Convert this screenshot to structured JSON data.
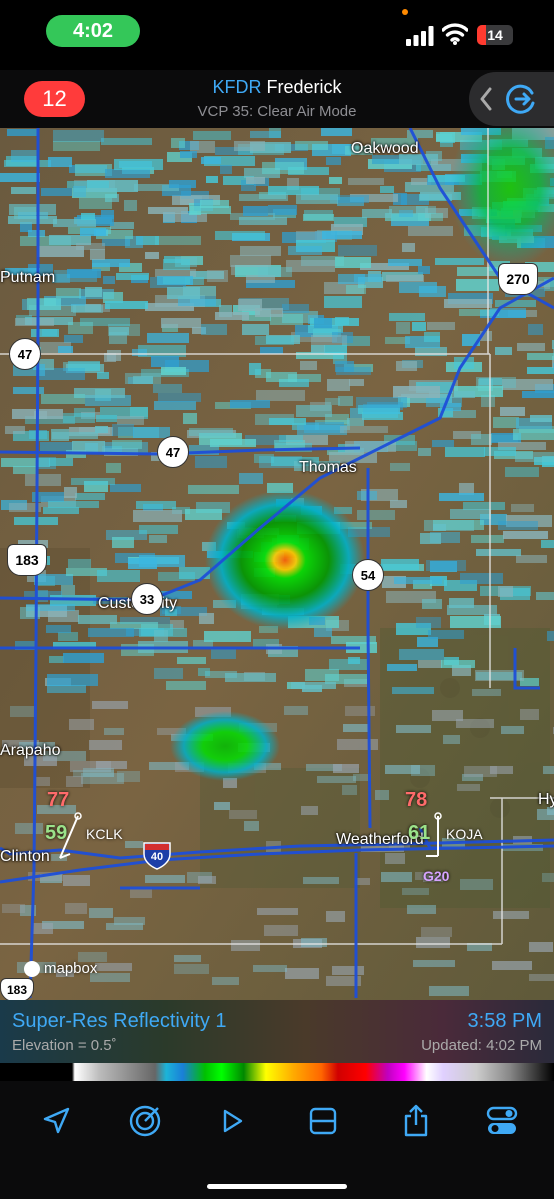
{
  "status": {
    "time": "4:02",
    "battery": "14"
  },
  "header": {
    "alerts_count": "12",
    "station_code": "KFDR",
    "station_name": "Frederick",
    "vcp": "VCP 35: Clear Air Mode"
  },
  "map": {
    "places": [
      "Oakwood",
      "Putnam",
      "Thomas",
      "Custer City",
      "Arapaho",
      "Clinton",
      "Weatherford"
    ],
    "routes": [
      "270",
      "47",
      "47",
      "183",
      "33",
      "54",
      "40",
      "183"
    ],
    "edge_label": "Hy",
    "stations": [
      {
        "id": "KCLK",
        "temp": "77",
        "dew": "59"
      },
      {
        "id": "KOJA",
        "temp": "78",
        "dew": "61"
      }
    ],
    "gust": "G20",
    "attribution": "mapbox"
  },
  "legend": {
    "product": "Super-Res Reflectivity 1",
    "elevation": "Elevation = 0.5˚",
    "valid_time": "3:58 PM",
    "updated": "Updated: 4:02 PM"
  },
  "toolbar": {
    "icons": [
      "location-arrow-icon",
      "radar-icon",
      "play-icon",
      "layout-icon",
      "share-icon",
      "settings-toggle-icon"
    ]
  }
}
